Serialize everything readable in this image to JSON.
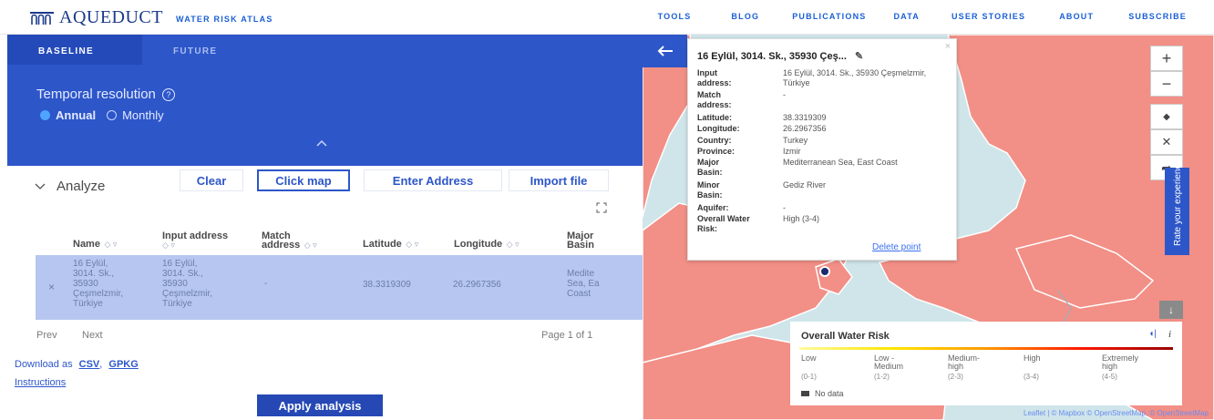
{
  "header": {
    "logo_text": "AQUEDUCT",
    "logo_sub": "WATER RISK ATLAS",
    "nav": [
      "TOOLS",
      "BLOG",
      "PUBLICATIONS",
      "DATA",
      "USER STORIES",
      "ABOUT",
      "SUBSCRIBE"
    ]
  },
  "sidebar": {
    "tabs": [
      {
        "label": "BASELINE",
        "active": true
      },
      {
        "label": "FUTURE",
        "active": false
      }
    ],
    "temporal_label": "Temporal resolution",
    "help_glyph": "?",
    "radio_annual": "Annual",
    "radio_monthly": "Monthly",
    "analyze_label": "Analyze",
    "buttons": {
      "clear": "Clear",
      "click_map": "Click map",
      "enter_address": "Enter Address",
      "import_file": "Import file"
    },
    "table": {
      "headers": {
        "name": "Name",
        "input": "Input address",
        "match": "Match address",
        "lat": "Latitude",
        "lon": "Longitude",
        "major": "Major Basin"
      },
      "row": {
        "name": "16 Eylül, 3014. Sk., 35930 Çeşmelzmir, Türkiye",
        "input": "16 Eylül, 3014. Sk., 35930 Çeşmelzmir, Türkiye",
        "match": "-",
        "lat": "38.3319309",
        "lon": "26.2967356",
        "major": "Medite Sea, Ea Coast"
      }
    },
    "pager": {
      "prev": "Prev",
      "next": "Next",
      "page": "Page 1 of 1"
    },
    "download_label": "Download as",
    "download_csv": "CSV",
    "download_gpkg": "GPKG",
    "instructions": "Instructions",
    "apply": "Apply analysis"
  },
  "popup": {
    "title": "16 Eylül, 3014. Sk., 35930 Çeş...",
    "fields": [
      {
        "label": "Input address:",
        "value": "16 Eylül, 3014. Sk., 35930 Çeşmelzmir, Türkiye"
      },
      {
        "label": "Match address:",
        "value": "-"
      },
      {
        "label": "Latitude:",
        "value": "38.3319309"
      },
      {
        "label": "Longitude:",
        "value": "26.2967356"
      },
      {
        "label": "Country:",
        "value": "Turkey"
      },
      {
        "label": "Province:",
        "value": "Izmir"
      },
      {
        "label": "Major Basin:",
        "value": "Mediterranean Sea, East Coast"
      },
      {
        "label": "Minor Basin:",
        "value": "Gediz River"
      },
      {
        "label": "Aquifer:",
        "value": "-"
      },
      {
        "label": "Overall Water Risk:",
        "value": "High (3-4)"
      }
    ],
    "delete": "Delete point"
  },
  "map": {
    "rate_label": "Rate your experience",
    "legend_title": "Overall Water Risk",
    "legend_items": [
      {
        "label": "Low",
        "range": "(0-1)"
      },
      {
        "label": "Low - Medium",
        "range": "(1-2)"
      },
      {
        "label": "Medium- high",
        "range": "(2-3)"
      },
      {
        "label": "High",
        "range": "(3-4)"
      },
      {
        "label": "Extremely high",
        "range": "(4-5)"
      }
    ],
    "no_data": "No data",
    "attribution": "Leaflet | © Mapbox © OpenStreetMap, © OpenStreetMap",
    "colors": {
      "land": "#f28f86",
      "water": "#cfe5ea",
      "accent": "#2d56c9"
    }
  }
}
